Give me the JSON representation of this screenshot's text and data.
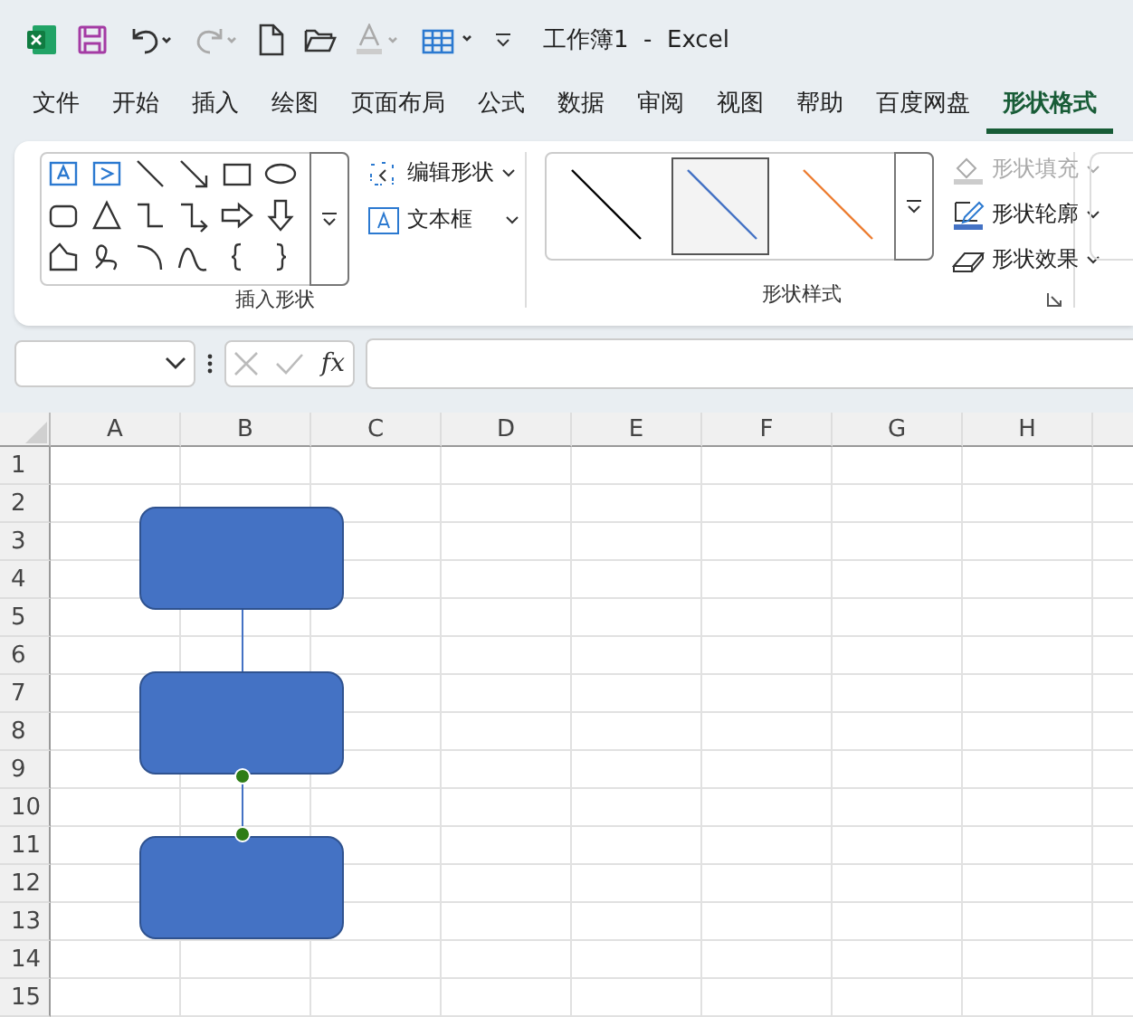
{
  "window": {
    "title": "工作簿1  -  Excel"
  },
  "tabs": [
    {
      "label": "文件",
      "selected": false
    },
    {
      "label": "开始",
      "selected": false
    },
    {
      "label": "插入",
      "selected": false
    },
    {
      "label": "绘图",
      "selected": false
    },
    {
      "label": "页面布局",
      "selected": false
    },
    {
      "label": "公式",
      "selected": false
    },
    {
      "label": "数据",
      "selected": false
    },
    {
      "label": "审阅",
      "selected": false
    },
    {
      "label": "视图",
      "selected": false
    },
    {
      "label": "帮助",
      "selected": false
    },
    {
      "label": "百度网盘",
      "selected": false
    },
    {
      "label": "形状格式",
      "selected": true
    }
  ],
  "ribbon": {
    "insert_shapes": {
      "label": "插入形状",
      "commands": [
        {
          "label": "编辑形状",
          "kind": "edit"
        },
        {
          "label": "文本框",
          "kind": "textbox"
        }
      ]
    },
    "shape_styles": {
      "label": "形状样式",
      "styles": [
        {
          "color": "#000000",
          "selected": false
        },
        {
          "color": "#4472c4",
          "selected": true
        },
        {
          "color": "#ed7d31",
          "selected": false
        }
      ],
      "commands": [
        {
          "label": "形状填充",
          "kind": "fill",
          "disabled": true
        },
        {
          "label": "形状轮廓",
          "kind": "outline",
          "disabled": false
        },
        {
          "label": "形状效果",
          "kind": "effects",
          "disabled": false
        }
      ]
    }
  },
  "formula_bar": {
    "function_label": "fx"
  },
  "sheet": {
    "columns": [
      "A",
      "B",
      "C",
      "D",
      "E",
      "F",
      "G",
      "H"
    ],
    "rows": [
      "1",
      "2",
      "3",
      "4",
      "5",
      "6",
      "7",
      "8",
      "9",
      "10",
      "11",
      "12",
      "13",
      "14",
      "15"
    ],
    "shapes": [
      {
        "kind": "rounded-rectangle",
        "color": "#4472c4"
      },
      {
        "kind": "rounded-rectangle",
        "color": "#4472c4"
      },
      {
        "kind": "rounded-rectangle",
        "color": "#4472c4"
      }
    ],
    "connectors": [
      {
        "selected": false
      },
      {
        "selected": true
      }
    ]
  }
}
